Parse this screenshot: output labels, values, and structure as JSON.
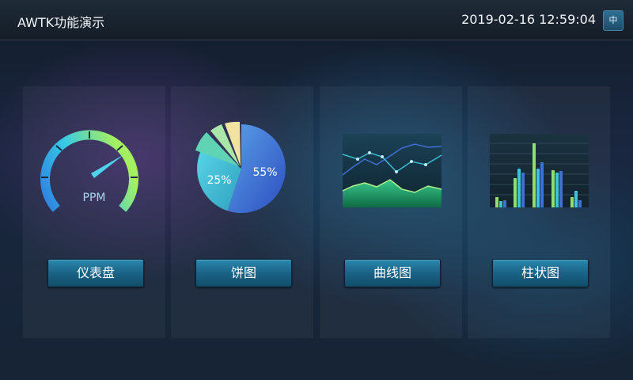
{
  "header": {
    "title": "AWTK功能演示",
    "datetime": "2019-02-16 12:59:04",
    "lang_label": "中"
  },
  "cards": [
    {
      "graphic_label": "PPM",
      "button_label": "仪表盘",
      "gauge_value": 0.62
    },
    {
      "button_label": "饼图",
      "pie_labels": [
        "55%",
        "25%"
      ]
    },
    {
      "button_label": "曲线图"
    },
    {
      "button_label": "柱状图"
    }
  ],
  "colors": {
    "button": "#1a6386",
    "accent": "#33c3e8"
  }
}
